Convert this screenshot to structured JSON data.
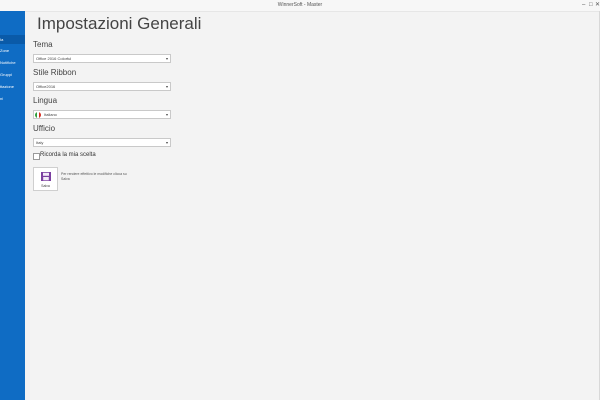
{
  "window": {
    "title": "WinnerSoft - Master",
    "controls": {
      "minimize": "–",
      "maximize": "□",
      "close": "✕"
    }
  },
  "sidebar": {
    "items": [
      {
        "label": "Ia",
        "active": true
      },
      {
        "label": "Zone",
        "active": false
      },
      {
        "label": "Notifiche",
        "active": false
      },
      {
        "label": "Gruppi",
        "active": false
      },
      {
        "label": "ttazione",
        "active": false
      },
      {
        "label": "ni",
        "active": false
      }
    ]
  },
  "main": {
    "title": "Impostazioni Generali",
    "tema": {
      "label": "Tema",
      "value": "Office 2016 Colorful"
    },
    "stile": {
      "label": "Stile Ribbon",
      "value": "Office2016"
    },
    "lingua": {
      "label": "Lingua",
      "value": "Italiano"
    },
    "ufficio": {
      "label": "Ufficio",
      "value": "Italy"
    },
    "remember": {
      "label": "Ricorda la mia scelta",
      "checked": false
    },
    "save": {
      "label": "Salva",
      "icon": "save-icon"
    },
    "info": "Per rendere effettivo le modifiche clicca su Salva"
  },
  "colors": {
    "sidebar": "#0f6cc4",
    "accent": "#7b3fa0"
  }
}
